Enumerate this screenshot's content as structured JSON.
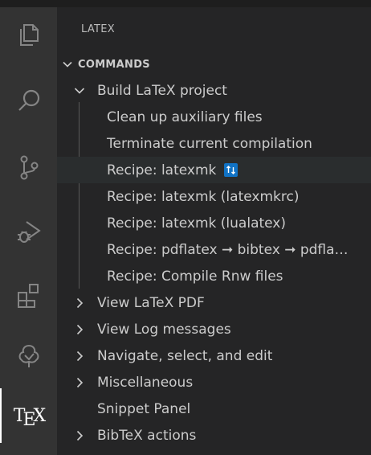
{
  "sidebar": {
    "title": "LATEX",
    "section": "COMMANDS"
  },
  "activity": {
    "items": [
      {
        "name": "explorer-icon"
      },
      {
        "name": "search-icon"
      },
      {
        "name": "source-control-icon"
      },
      {
        "name": "run-debug-icon"
      },
      {
        "name": "extensions-icon"
      },
      {
        "name": "tree-icon"
      },
      {
        "name": "tex-icon",
        "label_t": "T",
        "label_e": "E",
        "label_x": "X"
      }
    ]
  },
  "tree": {
    "build": "Build LaTeX project",
    "build_children": [
      "Clean up auxiliary files",
      "Terminate current compilation",
      "Recipe: latexmk",
      "Recipe: latexmk (latexmkrc)",
      "Recipe: latexmk (lualatex)",
      "Recipe: pdflatex ➞ bibtex ➞ pdfla…",
      "Recipe: Compile Rnw files"
    ],
    "others": [
      "View LaTeX PDF",
      "View Log messages",
      "Navigate, select, and edit",
      "Miscellaneous",
      "Snippet Panel",
      "BibTeX actions"
    ]
  },
  "colors": {
    "accent_badge": "#1173c5",
    "hover_row": "#2a2d2e"
  }
}
